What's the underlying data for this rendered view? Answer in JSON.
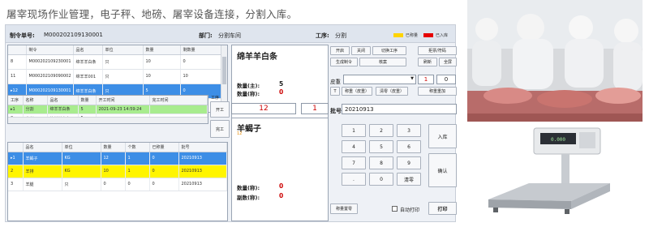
{
  "headline": "屠宰现场作业管理，电子秤、地磅、屠宰设备连接，分割入库。",
  "topbar": {
    "order_label": "制令单号:",
    "order_value": "M000202109130001",
    "dept_label": "部门:",
    "dept_value": "分割车间",
    "process_label": "工序:",
    "process_value": "分割",
    "legend_weighed": "已称量",
    "legend_stocked": "已入库",
    "color_weighed": "#ffd400",
    "color_stocked": "#e60000"
  },
  "order_table": {
    "headers": [
      "",
      "制令",
      "品名",
      "单位",
      "数量",
      "剩数量"
    ],
    "rows": [
      [
        "8",
        "M000202109230001",
        "绵羊羊白条",
        "只",
        "10",
        "0"
      ],
      [
        "11",
        "M000202109090002",
        "绵羊羊001",
        "只",
        "10",
        "10"
      ],
      [
        "12",
        "M000202109130001",
        "绵羊羊白条",
        "只",
        "5",
        "0"
      ]
    ]
  },
  "process_table": {
    "headers": [
      "工序",
      "名称",
      "品名",
      "数量",
      "开工时间",
      "完工时间"
    ],
    "rows": [
      [
        "1",
        "分割",
        "绵羊羊白条",
        "5",
        "2021-09-23 14:59:24",
        ""
      ],
      [
        "2",
        "分割",
        "绵羊羊白条",
        "5",
        "",
        ""
      ]
    ],
    "side_label": "工序",
    "start_btn": "开工",
    "finish_btn": "完工"
  },
  "item_table": {
    "headers": [
      "",
      "品名",
      "单位",
      "数量",
      "个数",
      "已称量",
      "批号"
    ],
    "rows": [
      [
        "1",
        "羊蝎子",
        "KG",
        "12",
        "1",
        "0",
        "20210913"
      ],
      [
        "2",
        "羊排",
        "KG",
        "10",
        "1",
        "0",
        "20210913"
      ],
      [
        "3",
        "羊腿",
        "只",
        "0",
        "0",
        "0",
        "20210913"
      ]
    ]
  },
  "product_top": {
    "name": "绵羊羊白条",
    "qty_main_label": "数量(主):",
    "qty_main": "5",
    "qty_weigh_label": "数量(称):",
    "qty_weigh": "0"
  },
  "product_bottom": {
    "name": "羊蝎子",
    "code": "12",
    "qty_weigh_label": "数量(称):",
    "qty_weigh": "0",
    "sub_qty_label": "副数(称):",
    "sub_qty": "0"
  },
  "counter": {
    "left": "12",
    "right": "1"
  },
  "batch": {
    "label": "批号",
    "value": "20210913"
  },
  "tare": {
    "label": "皮重",
    "value": "",
    "count": "1",
    "weight": "0"
  },
  "buttons": {
    "row1": [
      "开启",
      "关闭",
      "切换工序",
      "拒票/符码"
    ],
    "row2": [
      "生成制令",
      "核案",
      "刷新",
      "全屏"
    ],
    "t": "T",
    "tare_weigh": "称重（皮重）",
    "tare_clear": "清零（皮重）",
    "tare_repeat": "称重重加",
    "keypad": [
      "1",
      "2",
      "3",
      "4",
      "5",
      "6",
      "7",
      "8",
      "9",
      ".",
      "0",
      "清零"
    ],
    "stock": "入库",
    "confirm": "确认",
    "tare_set": "称量置零",
    "auto_print": "自动打印",
    "print": "打印"
  }
}
